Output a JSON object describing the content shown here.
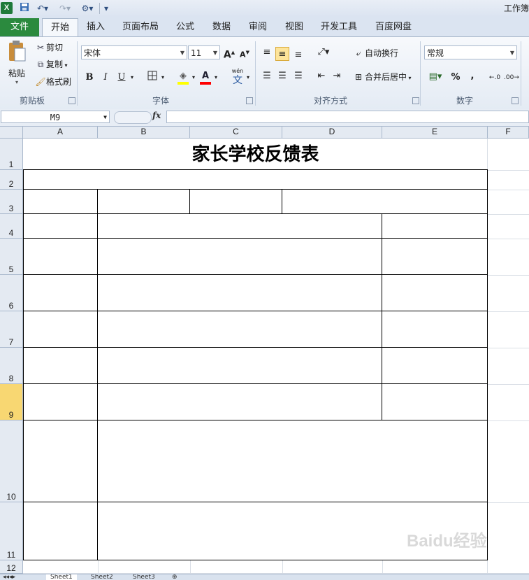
{
  "app": {
    "logo": "X",
    "window_title": "工作簿",
    "qat_icons": [
      "excel-logo-icon",
      "save-icon",
      "undo-icon",
      "redo-icon",
      "customize-icon"
    ]
  },
  "tabs": {
    "file": "文件",
    "items": [
      "开始",
      "插入",
      "页面布局",
      "公式",
      "数据",
      "审阅",
      "视图",
      "开发工具",
      "百度网盘"
    ],
    "active": "开始"
  },
  "ribbon": {
    "clipboard": {
      "paste": "粘贴",
      "cut": "剪切",
      "copy": "复制",
      "format_painter": "格式刷",
      "label": "剪贴板"
    },
    "font": {
      "font_name": "宋体",
      "font_size": "11",
      "grow": "A",
      "shrink": "A",
      "bold": "B",
      "italic": "I",
      "underline": "U",
      "font_color_letter": "A",
      "phonetic": "wén",
      "phonetic_char": "文",
      "label": "字体",
      "fill_color": "#ffff00",
      "font_color": "#ff0000"
    },
    "alignment": {
      "wrap_text": "自动换行",
      "merge_center": "合并后居中",
      "label": "对齐方式"
    },
    "number": {
      "format": "常规",
      "percent": "%",
      "comma": ",",
      "label": "数字"
    }
  },
  "formula_bar": {
    "name_box": "M9",
    "fx": "fx",
    "content": ""
  },
  "grid": {
    "columns": [
      "A",
      "B",
      "C",
      "D",
      "E",
      "F"
    ],
    "rows": [
      "1",
      "2",
      "3",
      "4",
      "5",
      "6",
      "7",
      "8",
      "9",
      "10",
      "11",
      "12"
    ],
    "active_row": "9",
    "title": "家长学校反馈表"
  },
  "sheet_tabs": [
    "Sheet1",
    "Sheet2",
    "Sheet3"
  ],
  "watermark": "Baidu经验"
}
